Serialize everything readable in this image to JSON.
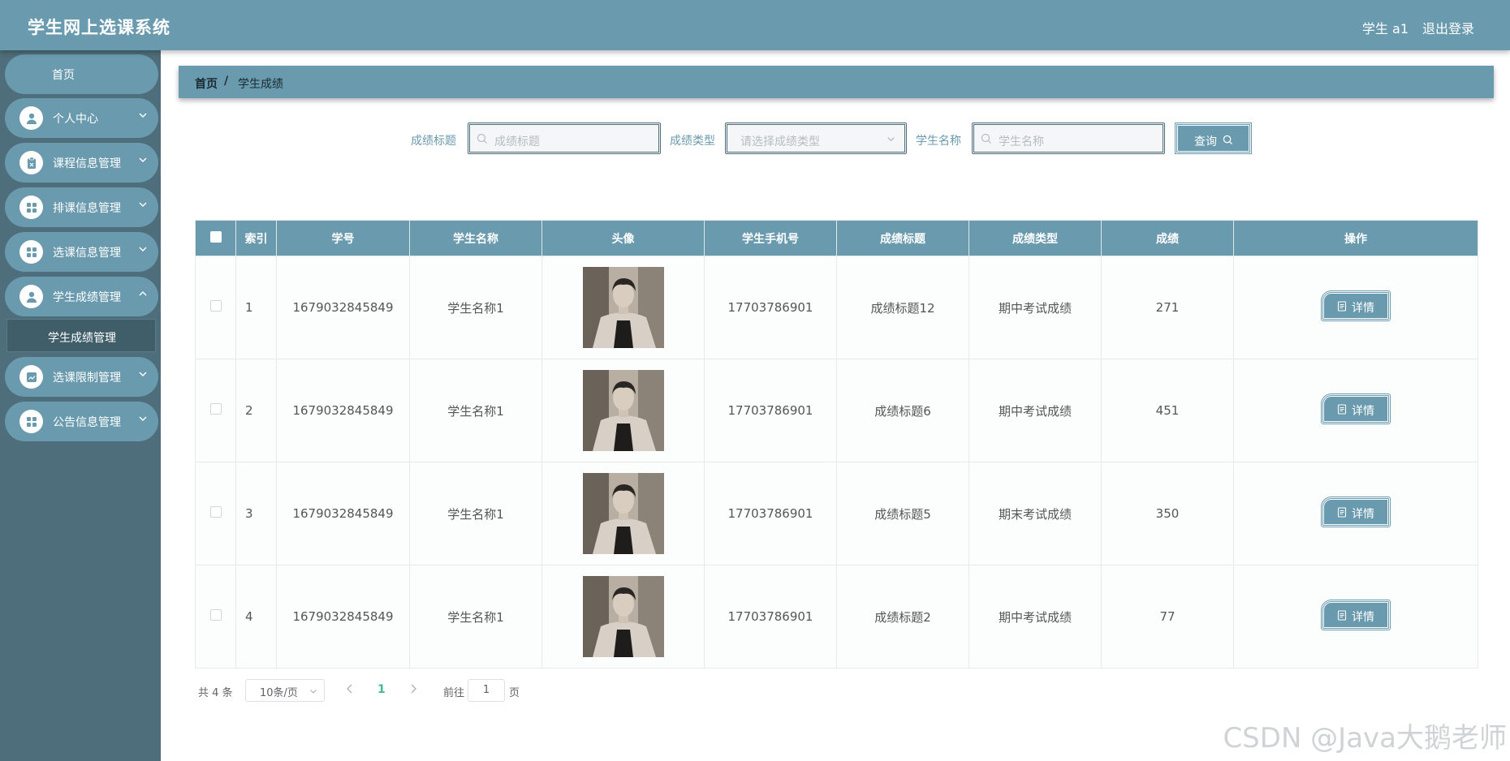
{
  "header": {
    "title": "学生网上选课系统",
    "user": "学生 a1",
    "logout": "退出登录"
  },
  "sidebar": {
    "home": "首页",
    "items": [
      {
        "label": "个人中心",
        "icon": "user-icon"
      },
      {
        "label": "课程信息管理",
        "icon": "clipboard-icon"
      },
      {
        "label": "排课信息管理",
        "icon": "grid-icon"
      },
      {
        "label": "选课信息管理",
        "icon": "grid-icon"
      },
      {
        "label": "学生成绩管理",
        "icon": "user-icon"
      },
      {
        "label": "选课限制管理",
        "icon": "chart-icon"
      },
      {
        "label": "公告信息管理",
        "icon": "grid-icon"
      }
    ],
    "active_sub": "学生成绩管理"
  },
  "breadcrumb": {
    "home": "首页",
    "sep": "/",
    "current": "学生成绩"
  },
  "search": {
    "title_label": "成绩标题",
    "title_placeholder": "成绩标题",
    "type_label": "成绩类型",
    "type_placeholder": "请选择成绩类型",
    "name_label": "学生名称",
    "name_placeholder": "学生名称",
    "query": "查询"
  },
  "table": {
    "columns": [
      "索引",
      "学号",
      "学生名称",
      "头像",
      "学生手机号",
      "成绩标题",
      "成绩类型",
      "成绩",
      "操作"
    ],
    "rows": [
      {
        "index": "1",
        "id": "1679032845849",
        "name": "学生名称1",
        "phone": "17703786901",
        "title": "成绩标题12",
        "type": "期中考试成绩",
        "score": "271",
        "action": "详情"
      },
      {
        "index": "2",
        "id": "1679032845849",
        "name": "学生名称1",
        "phone": "17703786901",
        "title": "成绩标题6",
        "type": "期中考试成绩",
        "score": "451",
        "action": "详情"
      },
      {
        "index": "3",
        "id": "1679032845849",
        "name": "学生名称1",
        "phone": "17703786901",
        "title": "成绩标题5",
        "type": "期末考试成绩",
        "score": "350",
        "action": "详情"
      },
      {
        "index": "4",
        "id": "1679032845849",
        "name": "学生名称1",
        "phone": "17703786901",
        "title": "成绩标题2",
        "type": "期中考试成绩",
        "score": "77",
        "action": "详情"
      }
    ]
  },
  "pagination": {
    "total": "共 4 条",
    "page_size": "10条/页",
    "current_page": "1",
    "goto": "前往",
    "goto_value": "1",
    "page_suffix": "页"
  },
  "watermark": "CSDN @Java大鹅老师",
  "colors": {
    "primary": "#6a9aae",
    "sidebar": "#4e6e7b",
    "active_page": "#40b89a"
  }
}
